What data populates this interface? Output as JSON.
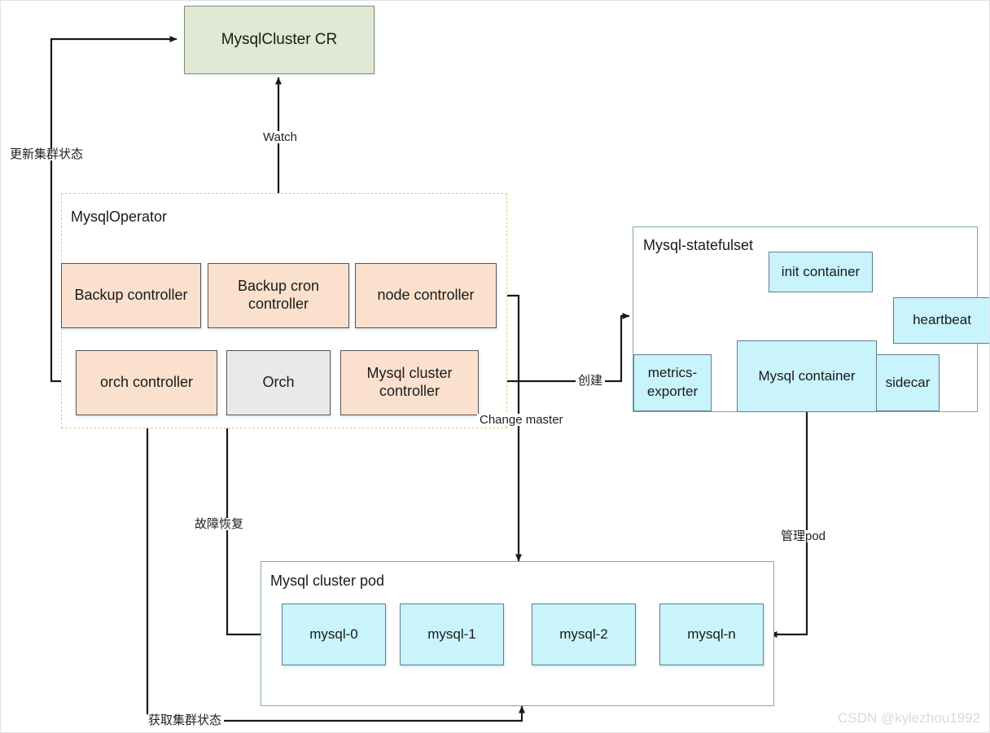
{
  "diagram": {
    "title_node": {
      "label": "MysqlCluster CR"
    },
    "operator": {
      "title": "MysqlOperator",
      "controllers": [
        {
          "label": "Backup controller"
        },
        {
          "label": "Backup cron controller"
        },
        {
          "label": "node controller"
        },
        {
          "label": "orch controller"
        },
        {
          "label": "Orch"
        },
        {
          "label": "Mysql cluster controller"
        }
      ]
    },
    "statefulset": {
      "title": "Mysql-statefulset",
      "containers": [
        {
          "label": "init container"
        },
        {
          "label": "heartbeat"
        },
        {
          "label": "metrics-exporter"
        },
        {
          "label": "Mysql container"
        },
        {
          "label": "sidecar"
        }
      ]
    },
    "pod": {
      "title": "Mysql cluster pod",
      "instances": [
        {
          "label": "mysql-0"
        },
        {
          "label": "mysql-1"
        },
        {
          "label": "mysql-2"
        },
        {
          "label": "mysql-n"
        }
      ]
    },
    "edges": [
      {
        "label": "更新集群状态"
      },
      {
        "label": "Watch"
      },
      {
        "label": "创建"
      },
      {
        "label": "Change master"
      },
      {
        "label": "故障恢复"
      },
      {
        "label": "管理pod"
      },
      {
        "label": "获取集群状态"
      }
    ],
    "watermark": "CSDN @kylezhou1992",
    "colors": {
      "cr_fill": "#dfe9d3",
      "controller_fill": "#fbe1cd",
      "orch_fill": "#e9e9e9",
      "container_fill": "#c9f4fb",
      "operator_border": "#e8c77a",
      "group_border": "#7fa8b0",
      "line": "#1a1a1a"
    }
  }
}
